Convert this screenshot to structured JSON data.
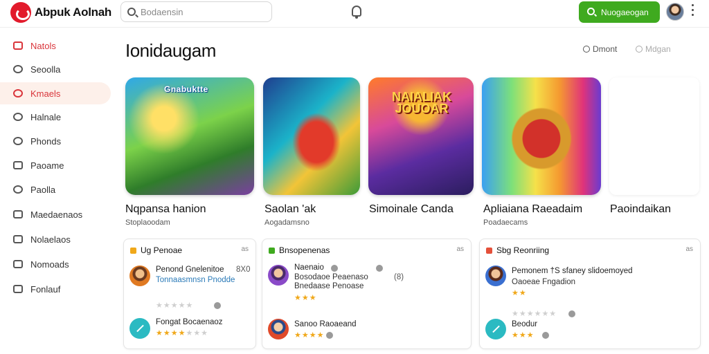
{
  "app": {
    "title": "Abpuk Aolnah",
    "brand_color": "#e21b2c"
  },
  "search": {
    "placeholder": "Bodaensin"
  },
  "topbar": {
    "cta_label": "Nuogaeogan",
    "cta_color": "#3faa1f",
    "bell_icon": "bell-icon",
    "avatar": "user-avatar"
  },
  "sidebar": {
    "items": [
      {
        "label": "Natols",
        "icon": "folder-icon"
      },
      {
        "label": "Seoolla",
        "icon": "search-icon"
      },
      {
        "label": "Kmaels",
        "icon": "search-icon",
        "active": true
      },
      {
        "label": "Halnale",
        "icon": "chat-icon"
      },
      {
        "label": "Phonds",
        "icon": "chat-icon"
      },
      {
        "label": "Paoame",
        "icon": "list-icon"
      },
      {
        "label": "Paolla",
        "icon": "chat-icon"
      },
      {
        "label": "Maedaenaos",
        "icon": "grid-icon"
      },
      {
        "label": "Nolaelaos",
        "icon": "image-icon"
      },
      {
        "label": "Nomoads",
        "icon": "download-icon"
      },
      {
        "label": "Fonlauf",
        "icon": "file-icon"
      }
    ]
  },
  "main": {
    "heading": "Ionidaugam",
    "actions": [
      {
        "label": "Dmont"
      },
      {
        "label": "Mdgan"
      }
    ]
  },
  "tiles": [
    {
      "art_text": "Gnabuktte",
      "name": "Nqpansa hanion",
      "sub": "Stoplaoodam"
    },
    {
      "art_text": "",
      "name": "Saolan 'ak",
      "sub": "Aogadamsno"
    },
    {
      "art_text": "NAIALIAK JOUOAR",
      "name": "Simoinale Canda",
      "sub": ""
    },
    {
      "art_text": "",
      "name": "Apliaiana Raeadaim",
      "sub": "Poadaecams"
    },
    {
      "art_text": "",
      "name": "Paoindaikan",
      "sub": ""
    }
  ],
  "cards": [
    {
      "header": "Ug Penoae",
      "header_color": "#f0a81a",
      "close": "as",
      "entries": [
        {
          "title": "Penond Gnelenitoe",
          "extra": "8X0",
          "desc": "Tonnaasmnsn Pnodde",
          "rating": 0
        },
        {
          "title": "Fongat Bocaenaoz",
          "rating": 4
        }
      ]
    },
    {
      "header": "Bnsopenenas",
      "header_color": "#3faa1f",
      "close": "as",
      "entries": [
        {
          "title": "Naenaio",
          "desc": "Bosodaoe Peaenaso Bnedaase Penoase",
          "extra": "(8)",
          "rating": 3
        },
        {
          "title": "Sanoo Raoaeand",
          "rating": 4
        }
      ]
    },
    {
      "header": "Sbg Reonriing",
      "header_color": "#e4503a",
      "close": "as",
      "entries": [
        {
          "title": "Pemonem †S sfaney slidoemoyed",
          "desc": "Oaoeae Fngadion",
          "rating": 2
        },
        {
          "title": "Beodur",
          "rating": 3
        }
      ]
    }
  ]
}
